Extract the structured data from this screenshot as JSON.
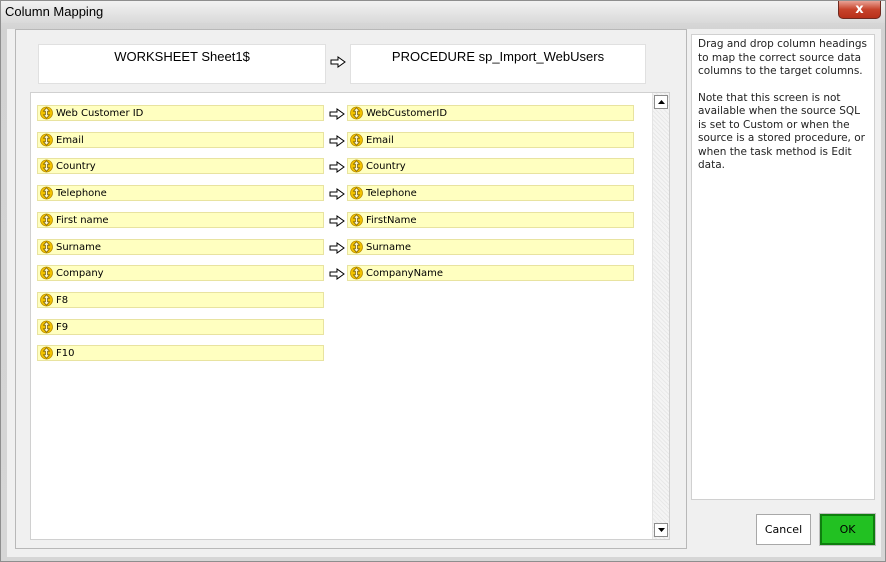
{
  "window": {
    "title": "Column Mapping",
    "close_label": "x"
  },
  "headers": {
    "source": "WORKSHEET Sheet1$",
    "target": "PROCEDURE sp_Import_WebUsers"
  },
  "source_columns": [
    "Web Customer ID",
    "Email",
    "Country",
    "Telephone",
    "First name",
    "Surname",
    "Company",
    "F8",
    "F9",
    "F10"
  ],
  "target_columns": [
    "WebCustomerID",
    "Email",
    "Country",
    "Telephone",
    "FirstName",
    "Surname",
    "CompanyName"
  ],
  "instructions": {
    "p1": "Drag and drop column headings to map the correct source data columns to the target columns.",
    "p2": "Note that this screen is not available when the source SQL is set to Custom or when the source is a stored procedure, or when the task method is Edit data."
  },
  "buttons": {
    "cancel": "Cancel",
    "ok": "OK"
  },
  "colors": {
    "field_bg": "#ffffc0",
    "ok_bg": "#22c122",
    "close_bg": "#c7432b"
  },
  "icons": {
    "field": "drag-updown-icon",
    "mapping": "right-arrow-icon"
  }
}
